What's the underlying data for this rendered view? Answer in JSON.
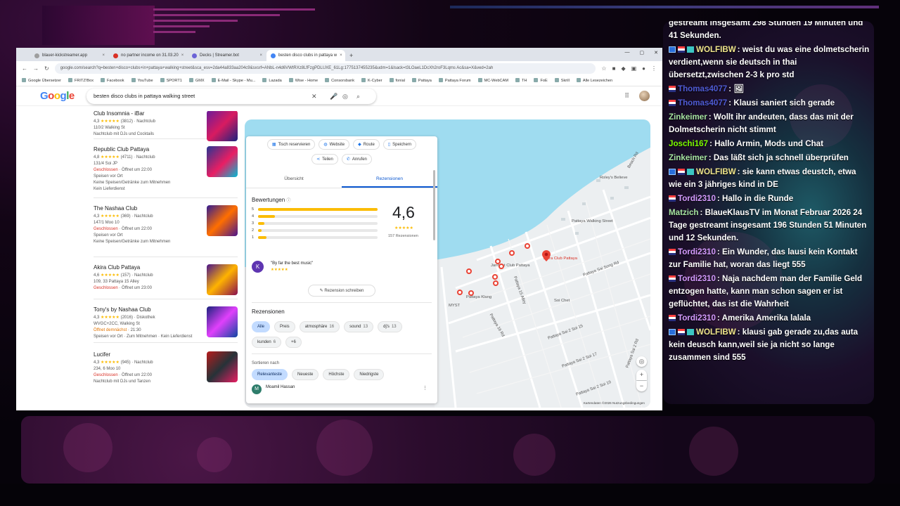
{
  "browser": {
    "tabs": [
      {
        "label": "blauer-kickstreamer.app",
        "color": "#9e9e9e"
      },
      {
        "label": "no partner income on 31.03.20",
        "color": "#d93025"
      },
      {
        "label": "Decks | Streamer.bot",
        "color": "#6b63d6"
      },
      {
        "label": "besten disco clubs in pattaya w",
        "color": "#4285f4"
      }
    ],
    "new_tab": "+",
    "url": "google.com/search?q=besten+disco+clubs+in+pattaya+walking+street&sca_esv=2da44a833aa204c9&sxsrf=ANbL-n4d6VWtRXz8LfFzgPDLUXE_61Lg:1775137455235&udm=1&lsack=t3LOaeL1DcXh2roF3Lqms Ac&sa=X&ved=2ah",
    "bookmarks": [
      "Google Übersetzer",
      "FRITZ!Box",
      "Facebook",
      "YouTube",
      "SPORT1",
      "GMX",
      "E-Mail - Skype - Mu...",
      "Lazada",
      "Wise - Home",
      "Consorsbank",
      "K-Cyber",
      "fonial",
      "Pattaya",
      "Pattaya Forum",
      "MC-WebCAM",
      "TH",
      "FoE",
      "Skrill",
      "Alle Lesezeichen"
    ]
  },
  "google": {
    "logo": [
      "G",
      "o",
      "o",
      "g",
      "l",
      "e"
    ],
    "query": "besten disco clubs in pattaya walking street"
  },
  "results": [
    {
      "name": "Club Insomnia - iBar",
      "rating": "4,3",
      "stars": "★★★★★",
      "reviews": "(3812)",
      "type": "Nachtclub",
      "address": "110/2 Walking St",
      "status": "",
      "status_note": "",
      "extra1": "Nachtclub mit DJs und Cocktails",
      "extra2": "",
      "extra3": ""
    },
    {
      "name": "Republic Club Pattaya",
      "rating": "4,8",
      "stars": "★★★★★",
      "reviews": "(4711)",
      "type": "Nachtclub",
      "address": "131/4 Soi JP",
      "status": "Geschlossen",
      "status_note": "· Öffnet um 22:00",
      "extra1": "Speisen vor Ort",
      "extra2": "Keine Speisen/Getränke zum Mitnehmen",
      "extra3": "Kein Lieferdienst"
    },
    {
      "name": "The Nashaa Club",
      "rating": "4,3",
      "stars": "★★★★★",
      "reviews": "(369)",
      "type": "Nachtclub",
      "address": "147/1 Moo 10",
      "status": "Geschlossen",
      "status_note": "· Öffnet um 22:00",
      "extra1": "Speisen vor Ort",
      "extra2": "Keine Speisen/Getränke zum Mitnehmen",
      "extra3": ""
    },
    {
      "name": "Akira Club Pattaya",
      "rating": "4,6",
      "stars": "★★★★★",
      "reviews": "(157)",
      "type": "Nachtclub",
      "address": "109, 33 Pattaya 15 Alley",
      "status": "Geschlossen",
      "status_note": "· Öffnet um 23:00",
      "extra1": "",
      "extra2": "",
      "extra3": ""
    },
    {
      "name": "Tony's by Nashaa Club",
      "rating": "4,3",
      "stars": "★★★★★",
      "reviews": "(2016)",
      "type": "Diskothek",
      "address": "WVGC+2CC, Walking St",
      "status": "Öffnet demnächst",
      "status_note": "· 21:30",
      "extra1": "Speisen vor Ort · Zum Mitnehmen · Kein Lieferdienst",
      "extra2": "",
      "extra3": ""
    },
    {
      "name": "Lucifer",
      "rating": "4,3",
      "stars": "★★★★★",
      "reviews": "(945)",
      "type": "Nachtclub",
      "address": "234, 6 Moo 10",
      "status": "Geschlossen",
      "status_note": "· Öffnet um 22:00",
      "extra1": "Nachtclub mit DJs und Tanzen",
      "extra2": "",
      "extra3": ""
    }
  ],
  "panel": {
    "actions": [
      "Tisch reservieren",
      "Website",
      "Route",
      "Speichern"
    ],
    "actions2": [
      "Teilen",
      "Anrufen"
    ],
    "tabs": [
      "Übersicht",
      "Rezensionen"
    ],
    "ratings_title": "Bewertungen",
    "ratings_info": "ⓘ",
    "distribution": [
      {
        "star": "5",
        "fraction": 1.0
      },
      {
        "star": "4",
        "fraction": 0.14
      },
      {
        "star": "3",
        "fraction": 0.05
      },
      {
        "star": "2",
        "fraction": 0.03
      },
      {
        "star": "1",
        "fraction": 0.07
      }
    ],
    "score": "4,6",
    "score_stars": "★★★★★",
    "count": "157 Rezensionen",
    "review_avatar": "K",
    "review_quote": "\"By far the best music\"",
    "review_stars": "★★★★★",
    "write_review": "Rezension schreiben",
    "reviews_title": "Rezensionen",
    "filters": [
      {
        "label": "Alle",
        "count": ""
      },
      {
        "label": "Preis",
        "count": ""
      },
      {
        "label": "atmosphäre",
        "count": "16"
      },
      {
        "label": "sound",
        "count": "13"
      },
      {
        "label": "dj's",
        "count": "13"
      },
      {
        "label": "kunden",
        "count": "6"
      },
      {
        "label": "+6",
        "count": ""
      }
    ],
    "sort_label": "Sortieren nach",
    "sorts": [
      "Relevanteste",
      "Neueste",
      "Höchste",
      "Niedrigste"
    ],
    "reviewer_avatar": "M",
    "reviewer_name": "Moamil Hassan"
  },
  "map": {
    "labels": [
      "Akira Club Pattaya",
      "Jannaat Club Pattaya",
      "Pattaya Walking Street",
      "Beach Rd",
      "Pattaya Sai Song Rd",
      "Pattaya Klang",
      "Soi Chet",
      "MYST",
      "Pattaya 16 Rd",
      "Pattaya Sai 2 Soi 15",
      "Pattaya Sai 2 Soi 17",
      "Pattaya Sai 2 Soi 19",
      "Pattaya 15 Alley",
      "Pattaya Sai 2 Rd",
      "Roley's Believe"
    ],
    "footer": "Kartendaten ©2026   Nutzungsbedingungen",
    "zoom_in": "+",
    "zoom_out": "−"
  },
  "chat": [
    {
      "badges": [],
      "user": "",
      "user_color": "#ffffff",
      "text": "gestreamt insgesamt 298 Stunden 19 Minuten und 41 Sekunden."
    },
    {
      "badges": [
        "mod",
        "flag",
        "sub"
      ],
      "user": "WOLFIBW",
      "user_color": "#f0e68c",
      "text": "weist du was eine dolmetscherin verdient,wenn sie deutsch in thai übersetzt,zwischen 2-3 k pro std"
    },
    {
      "badges": [
        "flag"
      ],
      "user": "Thomas4077",
      "user_color": "#4f5bd5",
      "text": "🖼"
    },
    {
      "badges": [
        "flag"
      ],
      "user": "Thomas4077",
      "user_color": "#4f5bd5",
      "text": "Klausi saniert sich gerade"
    },
    {
      "badges": [],
      "user": "Zinkeimer",
      "user_color": "#a6e3a1",
      "text": "Wollt ihr andeuten, dass das mit der Dolmetscherin nicht stimmt"
    },
    {
      "badges": [],
      "user": "Joschi167",
      "user_color": "#7cfc00",
      "text": "Hallo Armin, Mods und Chat"
    },
    {
      "badges": [],
      "user": "Zinkeimer",
      "user_color": "#a6e3a1",
      "text": "Das läßt sich ja schnell überprüfen"
    },
    {
      "badges": [
        "mod",
        "flag",
        "sub"
      ],
      "user": "WOLFIBW",
      "user_color": "#f0e68c",
      "text": "sie kann etwas deustch, etwa wie ein 3 jähriges kind in DE"
    },
    {
      "badges": [
        "flag"
      ],
      "user": "Tordi2310",
      "user_color": "#d59bff",
      "text": "Hallo in die Runde"
    },
    {
      "badges": [],
      "user": "Matzich",
      "user_color": "#a6e3a1",
      "text": "BlaueKlausTV im Monat Februar 2026 24 Tage gestreamt insgesamt 196 Stunden 51 Minuten und 12 Sekunden."
    },
    {
      "badges": [
        "flag"
      ],
      "user": "Tordi2310",
      "user_color": "#d59bff",
      "text": "Ein Wunder, das lausi kein Kontakt zur Familie hat, woran das liegt 555"
    },
    {
      "badges": [
        "flag"
      ],
      "user": "Tordi2310",
      "user_color": "#d59bff",
      "text": "Naja nachdem man der Familie Geld entzogen hatte, kann man schon sagen er ist geflüchtet, das ist die Wahrheit"
    },
    {
      "badges": [
        "flag"
      ],
      "user": "Tordi2310",
      "user_color": "#d59bff",
      "text": "Amerika Amerika lalala"
    },
    {
      "badges": [
        "mod",
        "flag",
        "sub"
      ],
      "user": "WOLFIBW",
      "user_color": "#f0e68c",
      "text": "klausi gab gerade zu,das auta kein deusch kann,weil sie ja nicht so lange zusammen sind 555"
    }
  ]
}
